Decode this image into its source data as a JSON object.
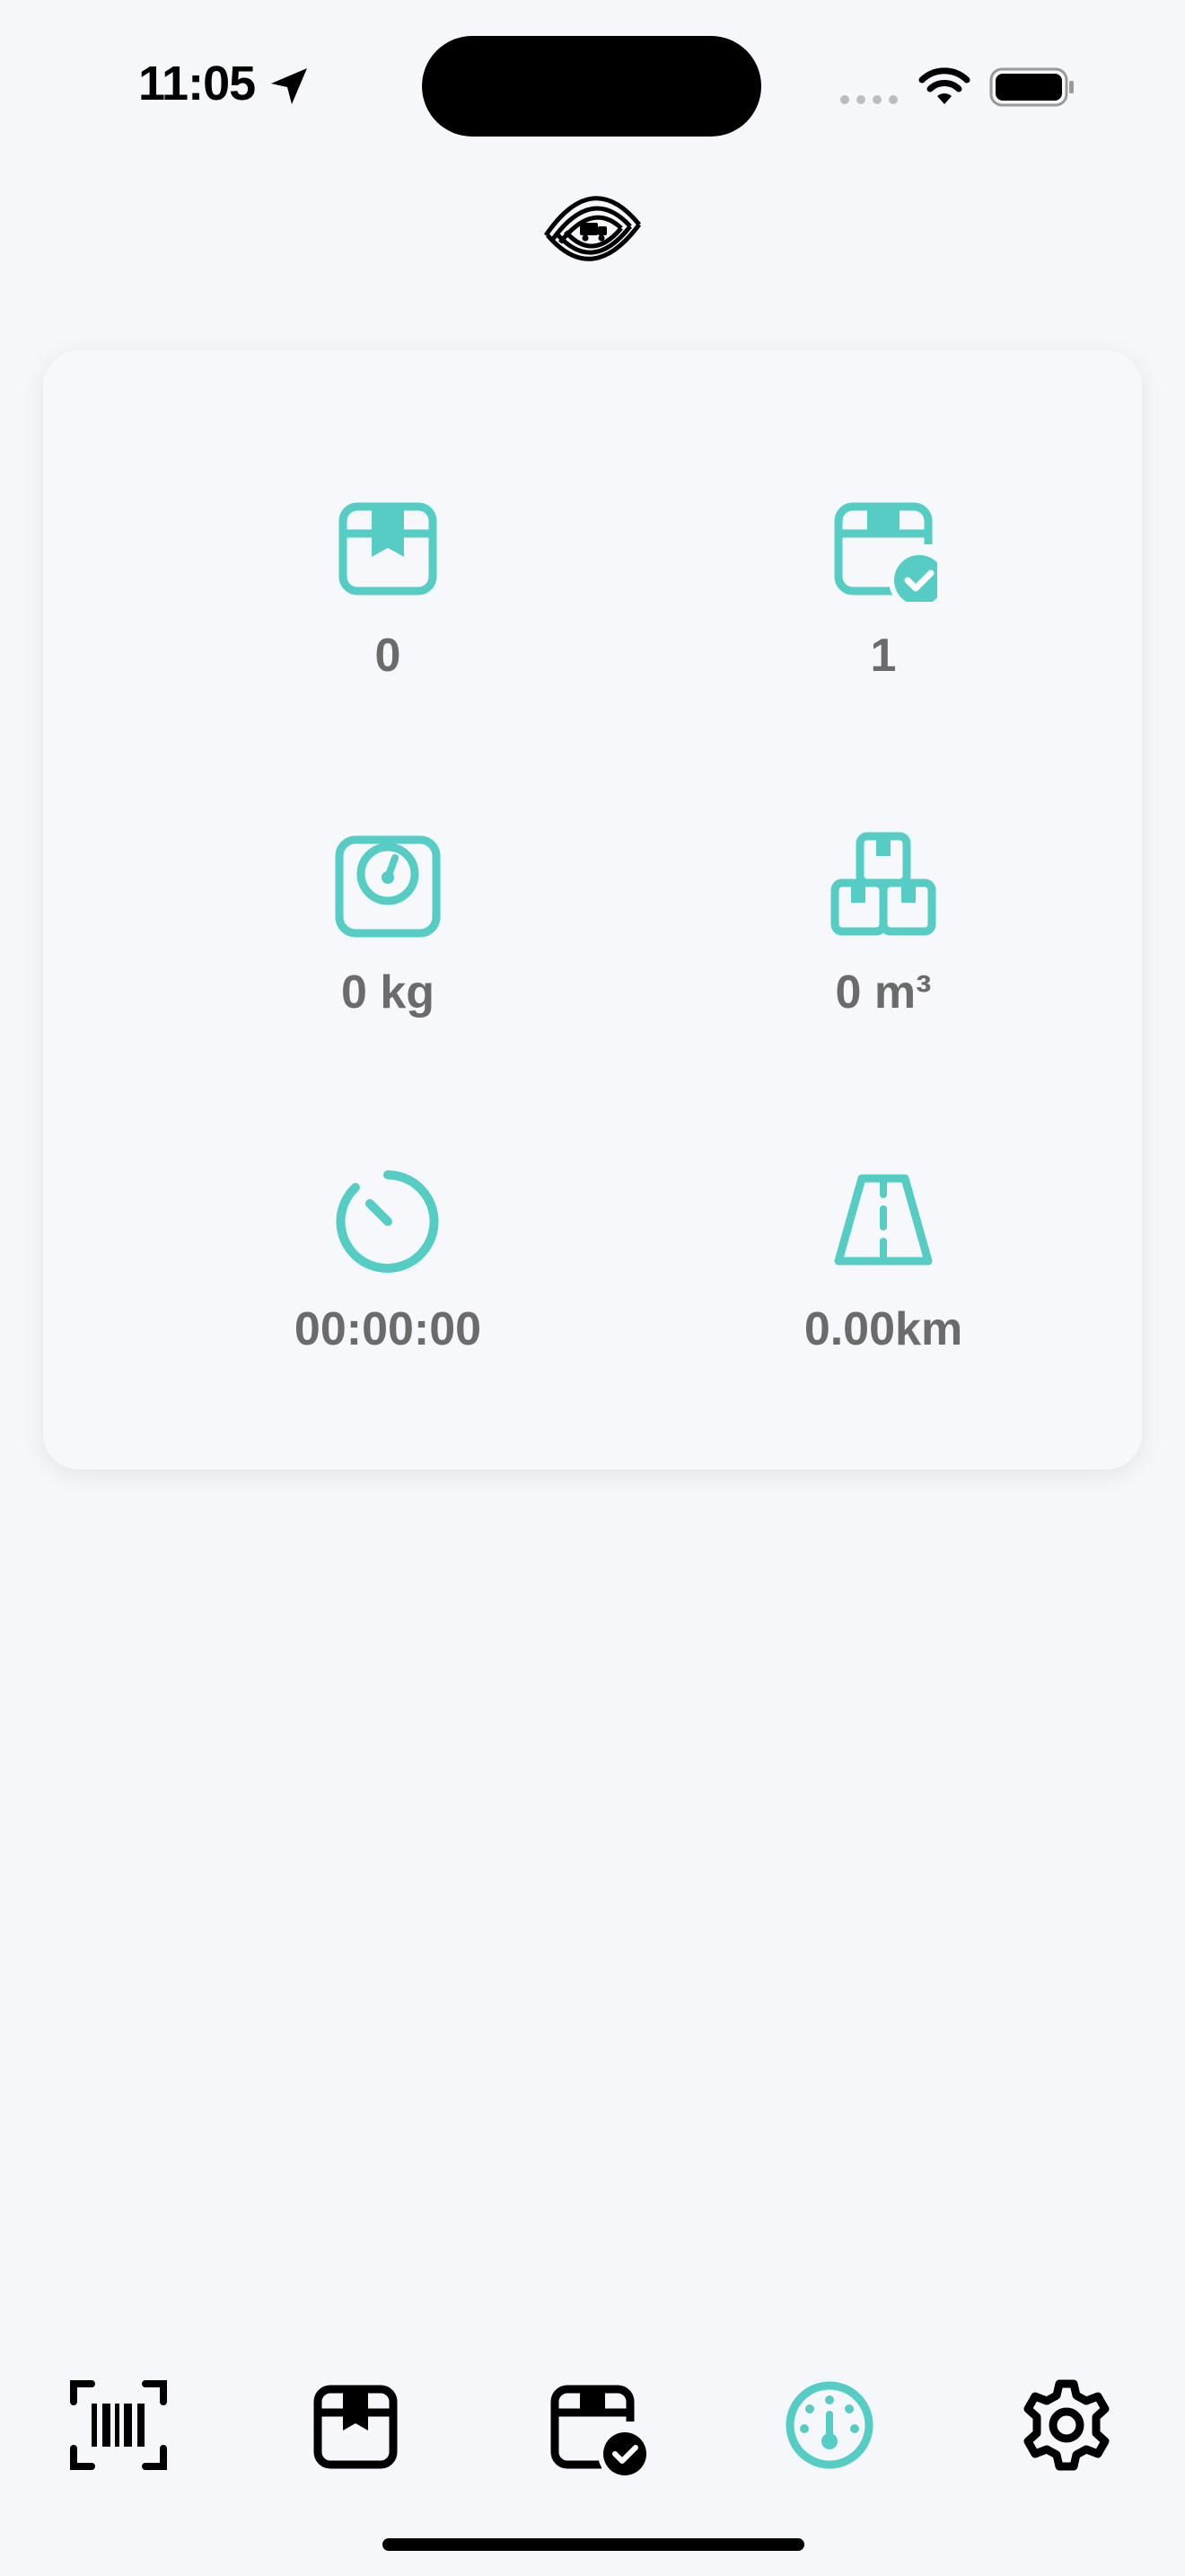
{
  "status_bar": {
    "time": "11:05"
  },
  "colors": {
    "accent": "#55CCC4",
    "background": "#F6F7FB",
    "value_text": "#6B6B6B",
    "icon_dark": "#000000"
  },
  "stats": {
    "open_packages": {
      "icon": "package-icon",
      "value": "0"
    },
    "delivered_packages": {
      "icon": "package-check-icon",
      "value": "1"
    },
    "weight": {
      "icon": "scale-icon",
      "value": "0 kg"
    },
    "volume": {
      "icon": "boxes-icon",
      "value": "0 m³"
    },
    "duration": {
      "icon": "timer-icon",
      "value": "00:00:00"
    },
    "distance": {
      "icon": "road-icon",
      "value": "0.00km"
    }
  },
  "tab_bar": {
    "active": "dashboard",
    "tabs": [
      {
        "id": "scan",
        "icon": "barcode-scan-icon"
      },
      {
        "id": "packages",
        "icon": "package-icon"
      },
      {
        "id": "delivered",
        "icon": "package-check-icon"
      },
      {
        "id": "dashboard",
        "icon": "gauge-icon"
      },
      {
        "id": "settings",
        "icon": "gear-icon"
      }
    ]
  }
}
